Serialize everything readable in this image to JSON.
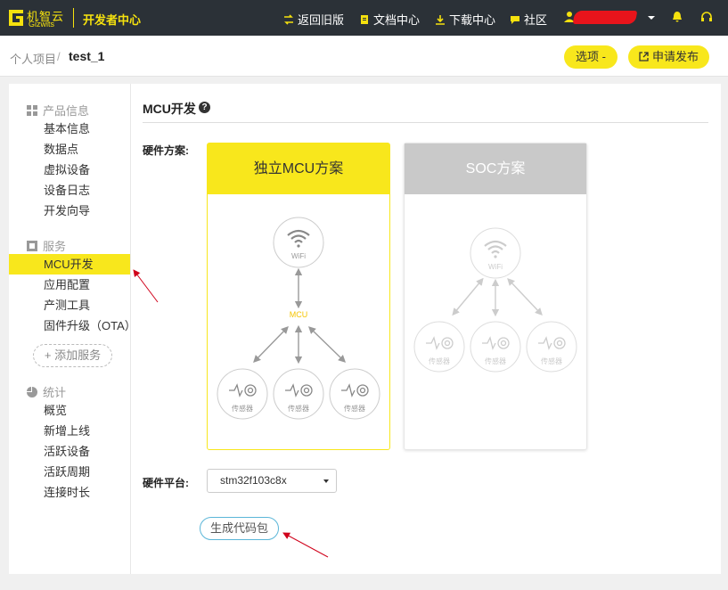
{
  "header": {
    "logo_cn": "机智云",
    "logo_en": "Gizwits",
    "site_title": "开发者中心",
    "nav": [
      {
        "label": "返回旧版",
        "icon": "switch-icon"
      },
      {
        "label": "文档中心",
        "icon": "document-icon"
      },
      {
        "label": "下载中心",
        "icon": "download-icon"
      },
      {
        "label": "社区",
        "icon": "chat-icon"
      }
    ],
    "user_icon": "user-icon",
    "bell_icon": "bell-icon",
    "support_icon": "headset-icon"
  },
  "breadcrumb": {
    "root": "个人项目",
    "separator": "/",
    "current": "test_1"
  },
  "actions": {
    "options": "选项 -",
    "publish": "申请发布"
  },
  "sidebar": {
    "sections": [
      {
        "title": "产品信息",
        "icon": "grid-icon",
        "items": [
          "基本信息",
          "数据点",
          "虚拟设备",
          "设备日志",
          "开发向导"
        ]
      },
      {
        "title": "服务",
        "icon": "service-icon",
        "items": [
          "MCU开发",
          "应用配置",
          "产测工具",
          "固件升级（OTA）"
        ]
      },
      {
        "title": "统计",
        "icon": "pie-chart-icon",
        "items": [
          "概览",
          "新增上线",
          "活跃设备",
          "活跃周期",
          "连接时长"
        ]
      }
    ],
    "active_item": "MCU开发",
    "add_service": "+ 添加服务"
  },
  "main": {
    "title": "MCU开发",
    "help_glyph": "?",
    "hardware_scheme_label": "硬件方案:",
    "schemes": [
      {
        "title": "独立MCU方案",
        "selected": true
      },
      {
        "title": "SOC方案",
        "selected": false
      }
    ],
    "diagram": {
      "wifi_label": "WiFi",
      "mcu_label": "MCU",
      "sensor_label": "传感器"
    },
    "hardware_platform_label": "硬件平台:",
    "platform_value": "stm32f103c8x",
    "generate_button": "生成代码包"
  },
  "colors": {
    "accent": "#f8e71c",
    "topbar": "#2b3137",
    "annotation": "#d0021b"
  }
}
